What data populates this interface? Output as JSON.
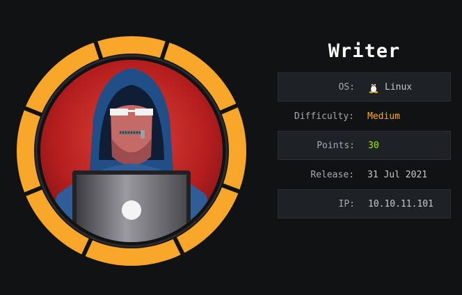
{
  "machine": {
    "name": "Writer",
    "avatar_icon": "hooded-hacker-with-laptop-icon",
    "difficulty_color": "#ffaf00",
    "points_color": "#9fef00"
  },
  "info": [
    {
      "label": "OS:",
      "value": "Linux",
      "icon": "tux-linux-icon"
    },
    {
      "label": "Difficulty:",
      "value": "Medium"
    },
    {
      "label": "Points:",
      "value": "30"
    },
    {
      "label": "Release:",
      "value": "31 Jul 2021"
    },
    {
      "label": "IP:",
      "value": "10.10.11.101"
    }
  ]
}
